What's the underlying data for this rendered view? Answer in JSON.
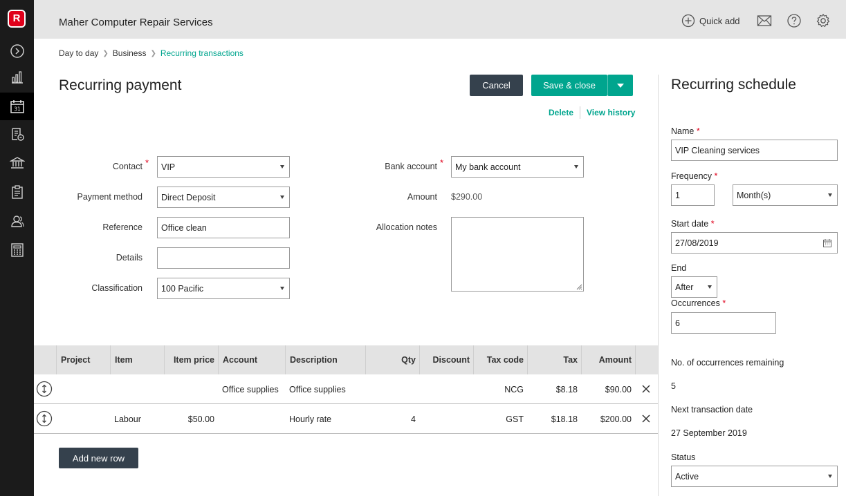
{
  "app": {
    "logo_letter": "R",
    "company_name": "Maher Computer Repair Services",
    "quick_add_label": "Quick add"
  },
  "nav_icons": [
    "expand-icon",
    "chart-icon",
    "calendar-icon",
    "receipt-icon",
    "bank-icon",
    "clipboard-icon",
    "contacts-icon",
    "calculator-icon"
  ],
  "nav_calendar_day": "31",
  "breadcrumb": {
    "item1": "Day to day",
    "item2": "Business",
    "current": "Recurring transactions"
  },
  "page": {
    "title": "Recurring payment",
    "cancel_label": "Cancel",
    "save_close_label": "Save & close",
    "delete_label": "Delete",
    "view_history_label": "View history"
  },
  "form": {
    "contact_label": "Contact",
    "contact_value": "VIP",
    "payment_method_label": "Payment method",
    "payment_method_value": "Direct Deposit",
    "reference_label": "Reference",
    "reference_value": "Office clean",
    "details_label": "Details",
    "details_value": "",
    "classification_label": "Classification",
    "classification_value": "100 Pacific",
    "bank_account_label": "Bank account",
    "bank_account_value": "My bank account",
    "amount_label": "Amount",
    "amount_value": "$290.00",
    "allocation_notes_label": "Allocation notes",
    "required_mark": "*"
  },
  "table": {
    "headers": {
      "project": "Project",
      "item": "Item",
      "item_price": "Item price",
      "account": "Account",
      "description": "Description",
      "qty": "Qty",
      "discount": "Discount",
      "tax_code": "Tax code",
      "tax": "Tax",
      "amount": "Amount"
    },
    "rows": [
      {
        "project": "",
        "item": "",
        "item_price": "",
        "account": "Office supplies",
        "description": "Office supplies",
        "qty": "",
        "discount": "",
        "tax_code": "NCG",
        "tax": "$8.18",
        "amount": "$90.00"
      },
      {
        "project": "",
        "item": "Labour",
        "item_price": "$50.00",
        "account": "",
        "description": "Hourly rate",
        "qty": "4",
        "discount": "",
        "tax_code": "GST",
        "tax": "$18.18",
        "amount": "$200.00"
      }
    ],
    "add_row_label": "Add new row"
  },
  "schedule": {
    "title": "Recurring schedule",
    "name_label": "Name",
    "name_value": "VIP Cleaning services",
    "frequency_label": "Frequency",
    "frequency_number": "1",
    "frequency_unit": "Month(s)",
    "start_date_label": "Start date",
    "start_date_value": "27/08/2019",
    "end_label": "End",
    "end_value": "After",
    "occurrences_label": "Occurrences",
    "occurrences_value": "6",
    "remaining_label": "No. of occurrences remaining",
    "remaining_value": "5",
    "next_date_label": "Next transaction date",
    "next_date_value": "27 September 2019",
    "status_label": "Status",
    "status_value": "Active"
  },
  "colors": {
    "accent": "#00a58e",
    "dark_button": "#35414d",
    "nav_bg": "#1b1b1b",
    "logo_red": "#e0001b"
  }
}
